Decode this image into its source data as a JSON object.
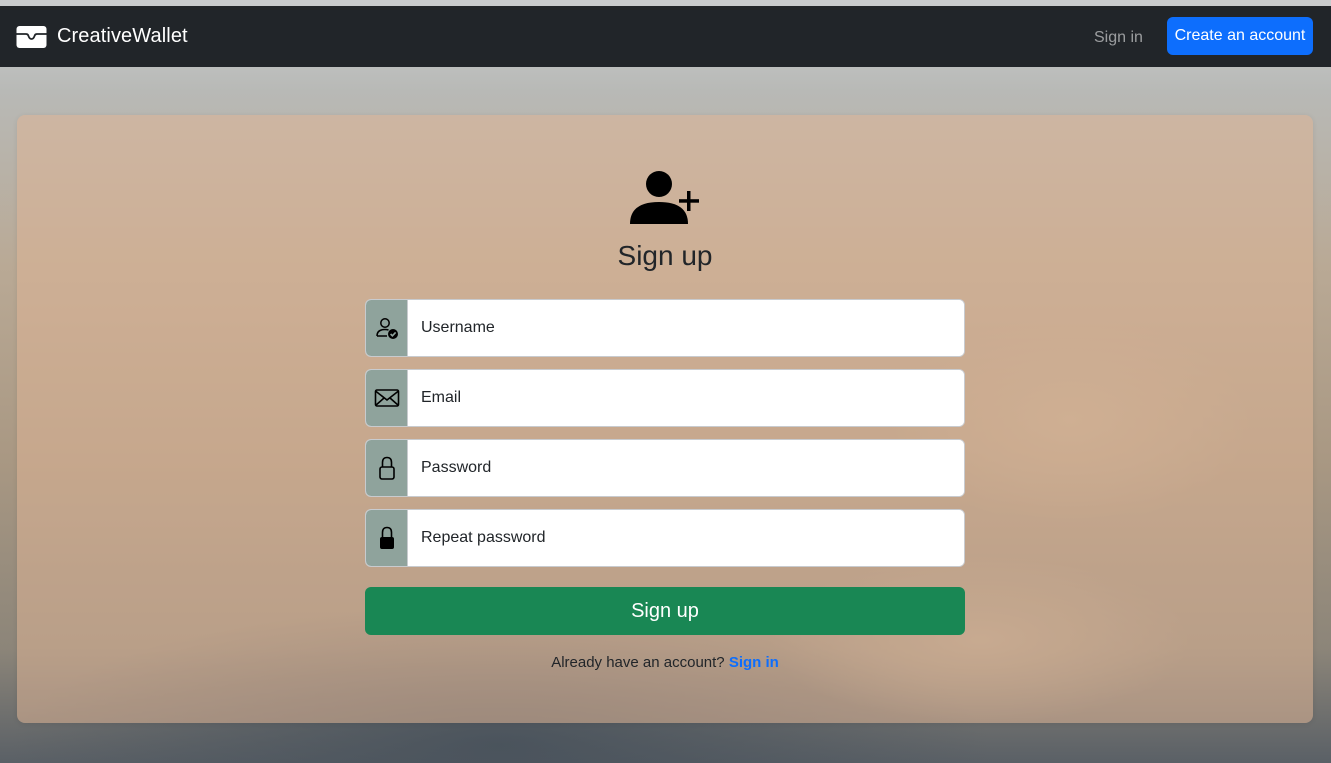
{
  "navbar": {
    "brand": "CreativeWallet",
    "brand_icon": "wallet-icon",
    "signin_label": "Sign in",
    "create_account_label": "Create an account"
  },
  "form": {
    "header_icon": "person-plus-icon",
    "title": "Sign up",
    "fields": [
      {
        "icon": "person-check-icon",
        "placeholder": "Username",
        "value": ""
      },
      {
        "icon": "envelope-icon",
        "placeholder": "Email",
        "value": ""
      },
      {
        "icon": "lock-open-icon",
        "placeholder": "Password",
        "value": ""
      },
      {
        "icon": "lock-fill-icon",
        "placeholder": "Repeat password",
        "value": ""
      }
    ],
    "submit_label": "Sign up",
    "footer_text": "Already have an account?",
    "footer_link": "Sign in"
  },
  "colors": {
    "navbar_bg": "#212529",
    "primary": "#0d6efd",
    "success": "#198754",
    "addon_bg": "#8fa39c"
  }
}
